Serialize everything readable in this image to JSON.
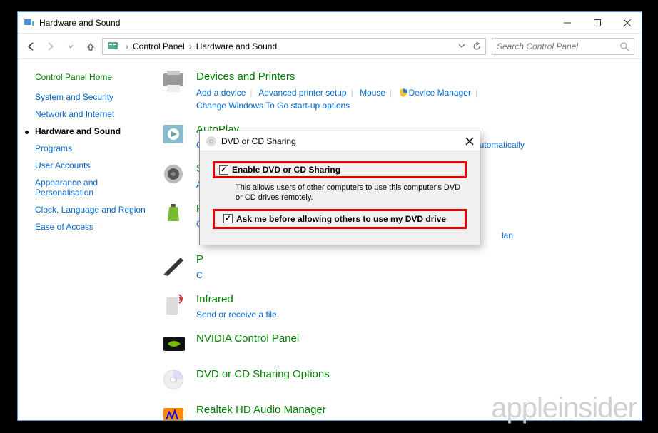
{
  "window": {
    "title": "Hardware and Sound"
  },
  "breadcrumb": {
    "root": "Control Panel",
    "current": "Hardware and Sound"
  },
  "search": {
    "placeholder": "Search Control Panel"
  },
  "sidebar": {
    "home": "Control Panel Home",
    "items": [
      {
        "label": "System and Security"
      },
      {
        "label": "Network and Internet"
      },
      {
        "label": "Hardware and Sound"
      },
      {
        "label": "Programs"
      },
      {
        "label": "User Accounts"
      },
      {
        "label": "Appearance and Personalisation"
      },
      {
        "label": "Clock, Language and Region"
      },
      {
        "label": "Ease of Access"
      }
    ]
  },
  "categories": {
    "devices": {
      "title": "Devices and Printers",
      "links": [
        "Add a device",
        "Advanced printer setup",
        "Mouse",
        "Device Manager",
        "Change Windows To Go start-up options"
      ]
    },
    "autoplay": {
      "title": "AutoPlay",
      "links": [
        "Change default settings for media or devices",
        "Play CDs or other media automatically"
      ]
    },
    "sound": {
      "title": "S",
      "links": [
        "A"
      ]
    },
    "power": {
      "title": "P",
      "link0": "C",
      "tail": "lan"
    },
    "pen": {
      "title": "P",
      "link0": "C"
    },
    "infrared": {
      "title": "Infrared",
      "link": "Send or receive a file"
    },
    "nvidia": {
      "title": "NVIDIA Control Panel"
    },
    "dvd": {
      "title": "DVD or CD Sharing Options"
    },
    "realtek": {
      "title": "Realtek HD Audio Manager"
    }
  },
  "dialog": {
    "title": "DVD or CD Sharing",
    "check1": "Enable DVD or CD Sharing",
    "desc": "This allows users of other computers to use this computer's DVD or CD drives remotely.",
    "check2": "Ask me before allowing others to use my DVD drive"
  },
  "watermark": "appleinsider"
}
